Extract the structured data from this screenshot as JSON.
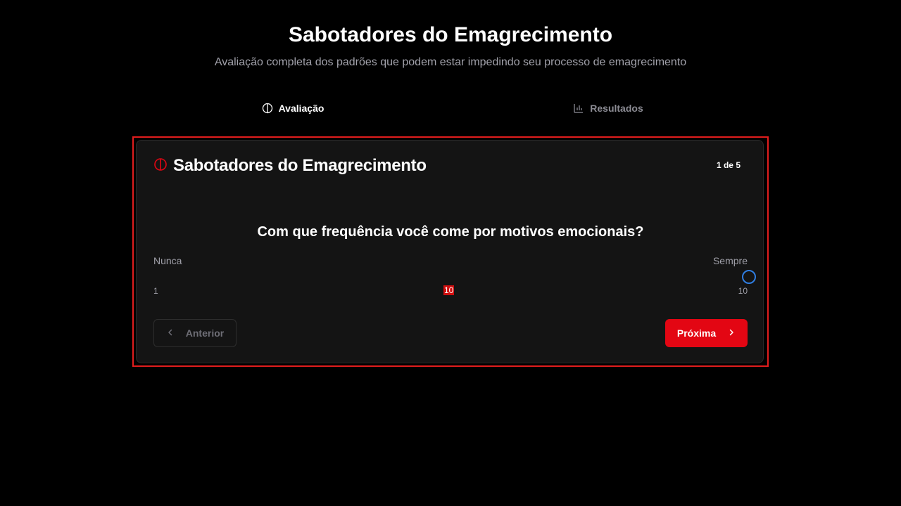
{
  "header": {
    "title": "Sabotadores do Emagrecimento",
    "subtitle": "Avaliação completa dos padrões que podem estar impedindo seu processo de emagrecimento"
  },
  "tabs": [
    {
      "label": "Avaliação",
      "icon": "brain-icon",
      "active": true
    },
    {
      "label": "Resultados",
      "icon": "bar-chart-icon",
      "active": false
    }
  ],
  "card": {
    "title": "Sabotadores do Emagrecimento",
    "icon": "brain-icon",
    "step_counter": "1 de 5",
    "question": "Com que frequência você come por motivos emocionais?",
    "scale": {
      "min_label": "Nunca",
      "max_label": "Sempre",
      "min_value": "1",
      "max_value": "10",
      "current_value": "10",
      "level": 1.0
    },
    "prev_button": "Anterior",
    "next_button": "Próxima"
  },
  "colors": {
    "accent": "#e30613",
    "thumb": "#2f7de1",
    "background": "#000000",
    "card": "#141414"
  }
}
